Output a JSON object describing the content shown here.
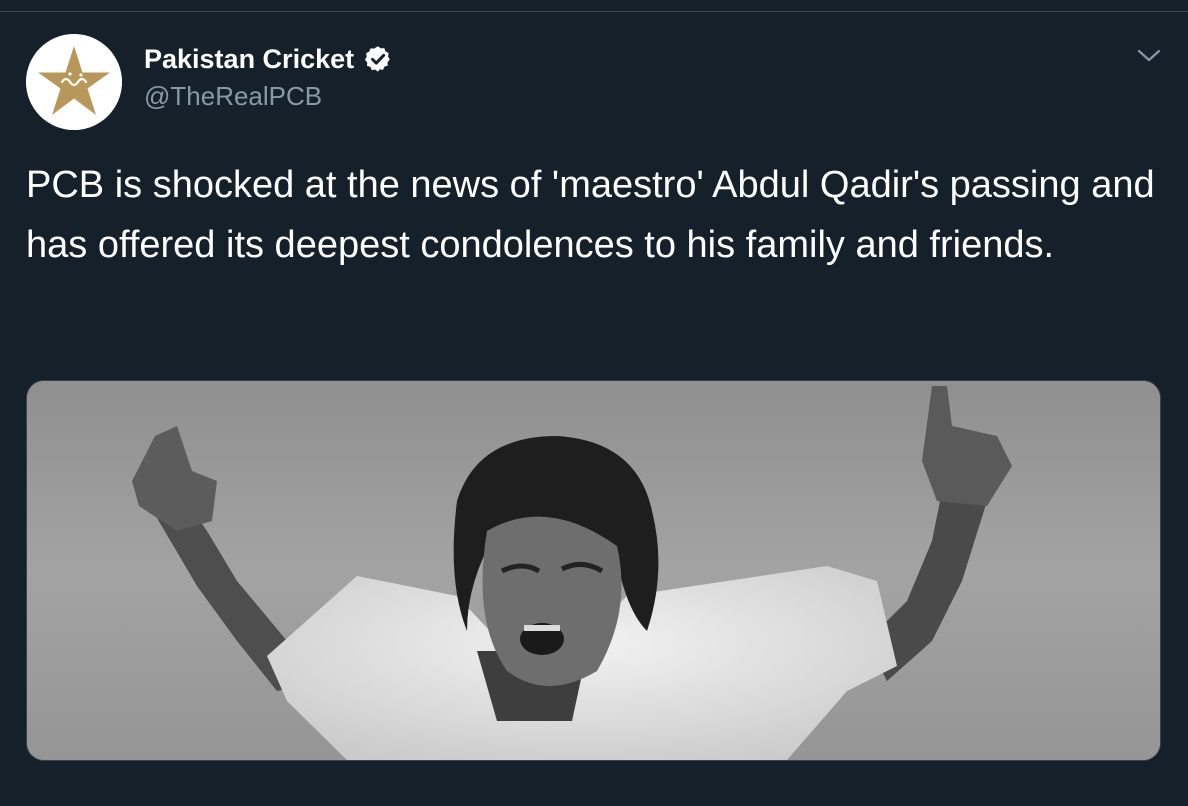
{
  "tweet": {
    "author": {
      "display_name": "Pakistan Cricket",
      "handle": "@TheRealPCB",
      "verified": true,
      "avatar": "pcb-star-logo"
    },
    "text": "PCB is shocked at the news of 'maestro' Abdul Qadir's passing and has offered its deepest condolences to his family and friends.",
    "menu_icon": "chevron-down-icon",
    "media": {
      "type": "photo",
      "style": "black-and-white"
    }
  },
  "colors": {
    "background": "#15202b",
    "text_primary": "#ffffff",
    "text_secondary": "#8899a6",
    "border": "#38444d",
    "logo_gold": "#b8985a"
  }
}
